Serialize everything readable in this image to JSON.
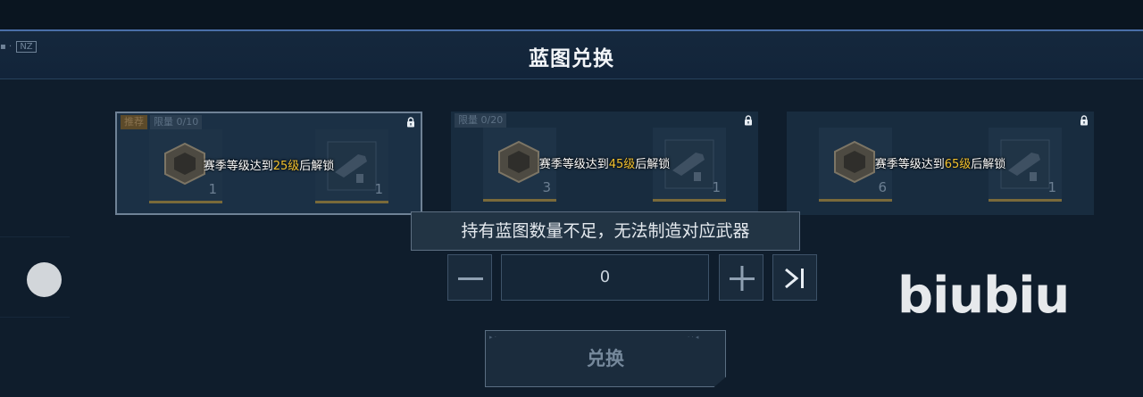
{
  "title": "蓝图兑换",
  "hud": {
    "tag": "NZ",
    "sub": ""
  },
  "cards": [
    {
      "badges": [
        {
          "label": "推荐",
          "kind": "rec"
        },
        {
          "label": "限量 0/10",
          "kind": "limit"
        }
      ],
      "left_count": "1",
      "right_count": "1",
      "msg_pre": "赛季等级达到",
      "level": "25级",
      "msg_post": "后解锁",
      "selected": true
    },
    {
      "badges": [
        {
          "label": "限量 0/20",
          "kind": "limit"
        }
      ],
      "left_count": "3",
      "right_count": "1",
      "msg_pre": "赛季等级达到",
      "level": "45级",
      "msg_post": "后解锁",
      "selected": false
    },
    {
      "badges": [],
      "left_count": "6",
      "right_count": "1",
      "msg_pre": "赛季等级达到",
      "level": "65级",
      "msg_post": "后解锁",
      "selected": false
    }
  ],
  "toast": "持有蓝图数量不足，无法制造对应武器",
  "quantity": "0",
  "exchange_label": "兑换",
  "watermark": "biubiu",
  "colors": {
    "accent_level": "#f2c230",
    "background": "#0f1d2c",
    "title_border": "#4a6fa8"
  },
  "icons": {
    "lock": "lock-icon",
    "minus": "minus-icon",
    "plus": "plus-icon",
    "max": "skip-to-max-icon",
    "box": "blueprint-box-icon",
    "gun": "weapon-icon"
  }
}
